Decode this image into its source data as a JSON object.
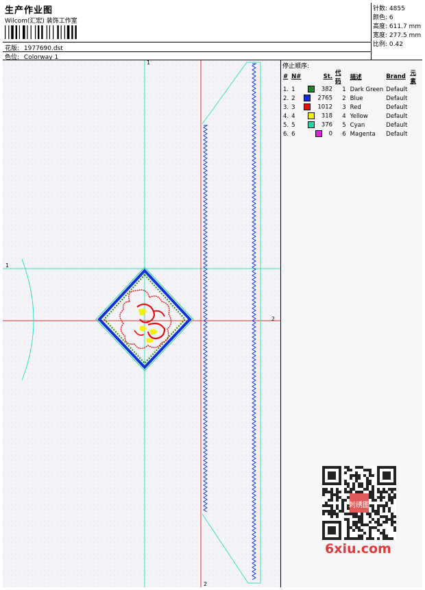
{
  "header": {
    "title": "生产作业图",
    "subtitle": "Wilcom(汇宏) 装饰工作室",
    "design_label": "花版:",
    "design_file": "1977690.dst",
    "colorway_label": "色位:",
    "colorway": "Colorway 1"
  },
  "stats": [
    {
      "label": "针数:",
      "value": "4855"
    },
    {
      "label": "颜色:",
      "value": "6"
    },
    {
      "label": "高度:",
      "value": "611.7 mm"
    },
    {
      "label": "宽度:",
      "value": "277.5 mm"
    },
    {
      "label": "比例:",
      "value": "0.42"
    }
  ],
  "stop_sequence": {
    "title": "停止顺序:",
    "headers": [
      "#",
      "N#",
      "St.",
      "代码",
      "描述",
      "Brand",
      "元素"
    ],
    "rows": [
      {
        "idx": "1.",
        "n": "1",
        "st": "382",
        "code": "1",
        "desc": "Dark Green",
        "brand": "Default",
        "color": "#1a8a2a"
      },
      {
        "idx": "2.",
        "n": "2",
        "st": "2765",
        "code": "2",
        "desc": "Blue",
        "brand": "Default",
        "color": "#1030d8"
      },
      {
        "idx": "3.",
        "n": "3",
        "st": "1012",
        "code": "3",
        "desc": "Red",
        "brand": "Default",
        "color": "#e01010"
      },
      {
        "idx": "4.",
        "n": "4",
        "st": "318",
        "code": "4",
        "desc": "Yellow",
        "brand": "Default",
        "color": "#f2ee10"
      },
      {
        "idx": "5.",
        "n": "5",
        "st": "376",
        "code": "5",
        "desc": "Cyan",
        "brand": "Default",
        "color": "#20d8a0"
      },
      {
        "idx": "6.",
        "n": "6",
        "st": "0",
        "code": "6",
        "desc": "Magenta",
        "brand": "Default",
        "color": "#e020e0"
      }
    ]
  },
  "canvas": {
    "axis_labels": {
      "v1": "1",
      "h1": "1",
      "h2": "2",
      "v2": "2"
    },
    "colors": {
      "guide_cyan": "#30e0c0",
      "guide_red": "#e03030",
      "blue": "#1030d8",
      "red": "#e01010",
      "yellow": "#f2ee10",
      "green": "#1a8a2a"
    }
  },
  "watermark": {
    "text": "6xiu.com",
    "logo_text": "刺绣图"
  }
}
